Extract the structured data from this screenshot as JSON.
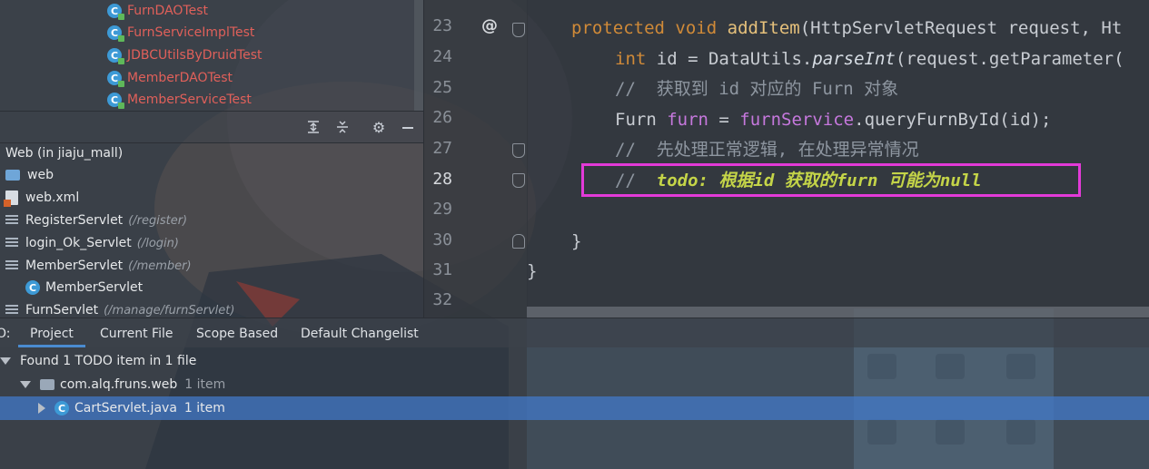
{
  "project_tree_top": {
    "items": [
      {
        "label": "FurnDAOTest"
      },
      {
        "label": "FurnServiceImplTest"
      },
      {
        "label": "JDBCUtilsByDruidTest"
      },
      {
        "label": "MemberDAOTest"
      },
      {
        "label": "MemberServiceTest"
      }
    ]
  },
  "toolbar": {
    "icons": [
      "expand-all-icon",
      "collapse-all-icon",
      "gear-icon",
      "minimize-icon"
    ]
  },
  "project_tree_bottom": {
    "module": "Web (in jiaju_mall)",
    "items": [
      {
        "label": "web",
        "hint": ""
      },
      {
        "label": "web.xml",
        "hint": ""
      },
      {
        "label": "RegisterServlet",
        "hint": "(/register)"
      },
      {
        "label": "login_Ok_Servlet",
        "hint": "(/login)"
      },
      {
        "label": "MemberServlet",
        "hint": "(/member)"
      },
      {
        "label": "MemberServlet",
        "hint": ""
      },
      {
        "label": "FurnServlet",
        "hint": "(/manage/furnServlet)"
      }
    ]
  },
  "editor": {
    "line_numbers": [
      "23",
      "24",
      "25",
      "26",
      "27",
      "28",
      "29",
      "30",
      "31",
      "32"
    ],
    "active_line": "28",
    "override_marker": "@",
    "lines": {
      "l23": {
        "kw1": "protected",
        "kw2": "void",
        "fn": "addItem",
        "rest": "(HttpServletRequest request, Ht"
      },
      "l24": {
        "kw": "int",
        "a": " id = DataUtils.",
        "it": "parseInt",
        "b": "(request.getParameter("
      },
      "l25": "//  获取到 id 对应的 Furn 对象",
      "l26": {
        "a": "Furn ",
        "b": "furn",
        "c": " = ",
        "d": "furnService",
        "e": ".queryFurnById(id);"
      },
      "l27": "//  先处理正常逻辑, 在处理异常情况",
      "l28": {
        "slashes": "//  ",
        "todo": "todo: 根据id 获取的furn 可能为null"
      },
      "l30": "}",
      "l31": "}"
    }
  },
  "todo_panel": {
    "prefix": "O:",
    "tabs": [
      "Project",
      "Current File",
      "Scope Based",
      "Default Changelist"
    ],
    "active_tab": "Project",
    "summary": "Found 1 TODO item in 1 file",
    "package": {
      "label": "com.alq.fruns.web",
      "count": "1 item"
    },
    "file": {
      "label": "CartServlet.java",
      "count": "1 item"
    }
  },
  "colors": {
    "highlight_border": "#e33ad8",
    "selection": "#4278c8",
    "todo_text": "#c4d448"
  }
}
